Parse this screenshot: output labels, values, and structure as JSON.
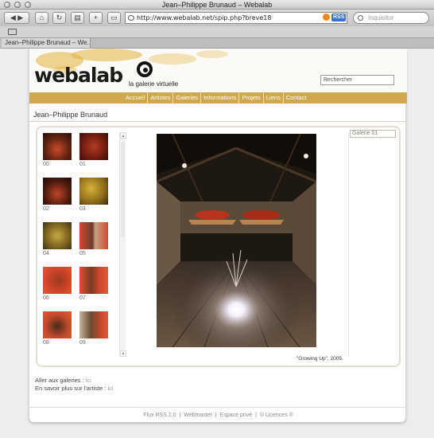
{
  "window": {
    "title": "Jean–Philippe Brunaud – Webalab",
    "url": "http://www.webalab.net/spip.php?breve18",
    "rss_label": "RSS",
    "search_placeholder": "Inquisitor",
    "tab_label": "Jean–Philippe Brunaud – We..."
  },
  "site": {
    "logo_text": "webalab",
    "tagline": "la galerie virtuelle",
    "search_placeholder": "Rechercher",
    "accent": "#cfa84d"
  },
  "menu": [
    "Accueil",
    "Artistes",
    "Galeries",
    "Informations",
    "Projets",
    "Liens",
    "Contact"
  ],
  "page": {
    "heading": "Jean–Philippe Brunaud",
    "gallery_tag": "Galerie 01",
    "caption": "\"Growing Up\", 2005.",
    "thumbnails": [
      "00",
      "01",
      "02",
      "03",
      "04",
      "05",
      "06",
      "07",
      "08",
      "09"
    ]
  },
  "links": {
    "galleries_text": "Aller aux galeries : ",
    "galleries_link": "ici",
    "artist_text": "En savoir plus sur l'artiste : ",
    "artist_link": "ici"
  },
  "footer": [
    "Flux RSS 2.0",
    "Webmaster",
    "Espace privé",
    "© Licences ®"
  ]
}
